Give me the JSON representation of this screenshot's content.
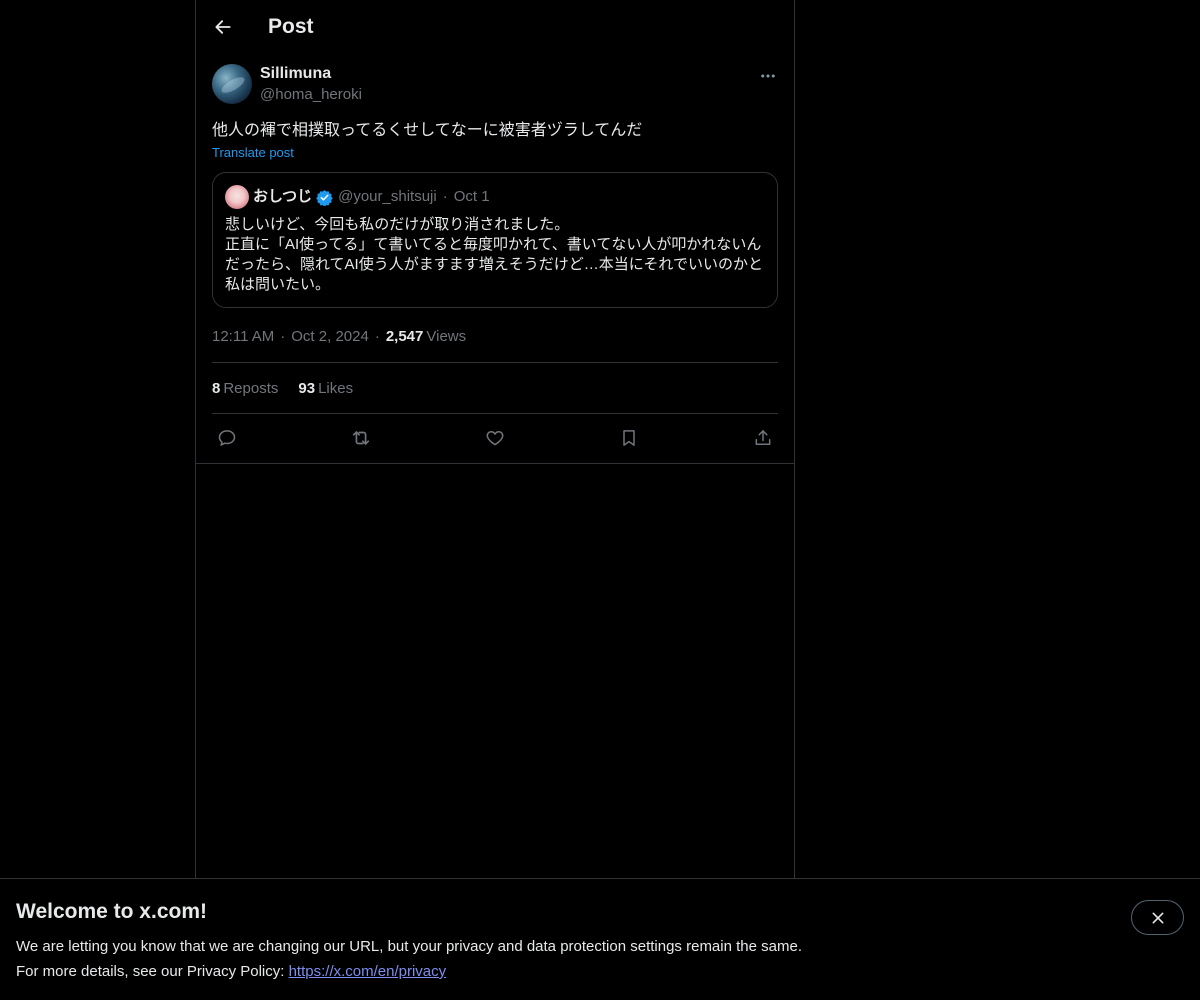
{
  "header": {
    "title": "Post"
  },
  "post": {
    "author": {
      "display_name": "Sillimuna",
      "handle": "@homa_heroki"
    },
    "text": "他人の褌で相撲取ってるくせしてなーに被害者ヅラしてんだ",
    "translate_label": "Translate post",
    "quote": {
      "display_name": "おしつじ",
      "handle": "@your_shitsuji",
      "separator": "·",
      "date": "Oct 1",
      "verified": true,
      "text": "悲しいけど、今回も私のだけが取り消されました。\n正直に「AI使ってる」て書いてると毎度叩かれて、書いてない人が叩かれないんだったら、隠れてAI使う人がますます増えそうだけど…本当にそれでいいのかと私は問いたい。"
    },
    "meta": {
      "time": "12:11 AM",
      "date": "Oct 2, 2024",
      "separator": "·",
      "views_count": "2,547",
      "views_label": "Views"
    },
    "stats": {
      "reposts_count": "8",
      "reposts_label": "Reposts",
      "likes_count": "93",
      "likes_label": "Likes"
    },
    "actions": [
      "reply-icon",
      "repost-icon",
      "like-icon",
      "bookmark-icon",
      "share-icon"
    ]
  },
  "banner": {
    "title": "Welcome to x.com!",
    "line1": "We are letting you know that we are changing our URL, but your privacy and data protection settings remain the same.",
    "line2_prefix": "For more details, see our Privacy Policy: ",
    "link": "https://x.com/en/privacy"
  },
  "colors": {
    "background": "#000000",
    "text": "#e7e9ea",
    "secondary": "#71767b",
    "accent": "#1d9bf0",
    "border": "#2f3336",
    "link": "#7c8eef"
  }
}
